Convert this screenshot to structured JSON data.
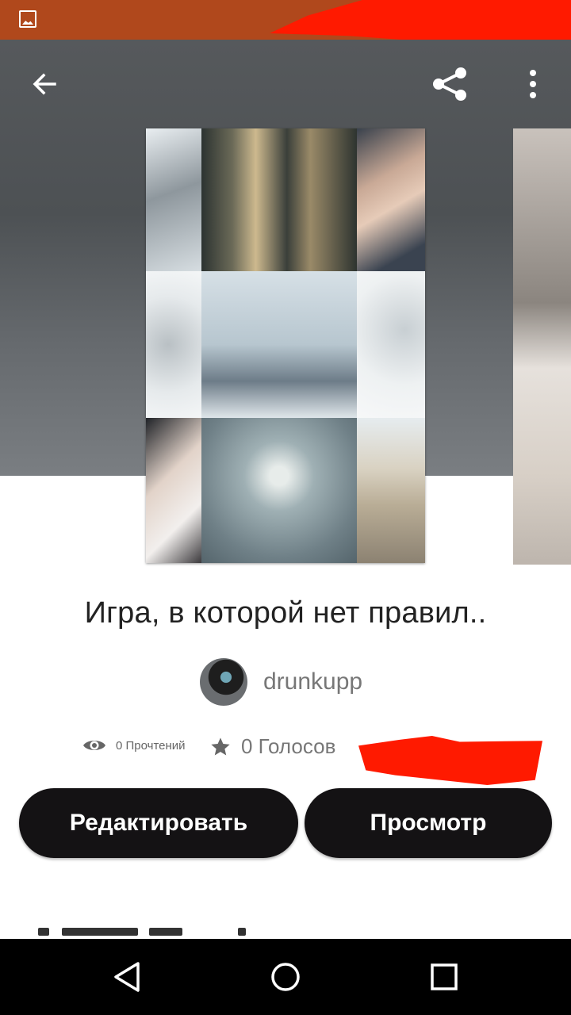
{
  "status_bar": {
    "background": "#b0481c",
    "icons": [
      "image-icon"
    ]
  },
  "toolbar": {
    "icons": [
      "back-arrow-icon",
      "share-icon",
      "more-vert-icon"
    ]
  },
  "story": {
    "title": "Игра, в которой нет правил..",
    "author": "drunkupp",
    "reads_label": "0 Прочтений",
    "votes_label": "0 Голосов"
  },
  "buttons": {
    "edit_label": "Редактировать",
    "view_label": "Просмотр"
  },
  "navbar": {
    "icons": [
      "back-triangle-icon",
      "home-circle-icon",
      "recents-square-icon"
    ]
  },
  "colors": {
    "button_bg": "#141214",
    "redaction": "#ff1a00"
  }
}
